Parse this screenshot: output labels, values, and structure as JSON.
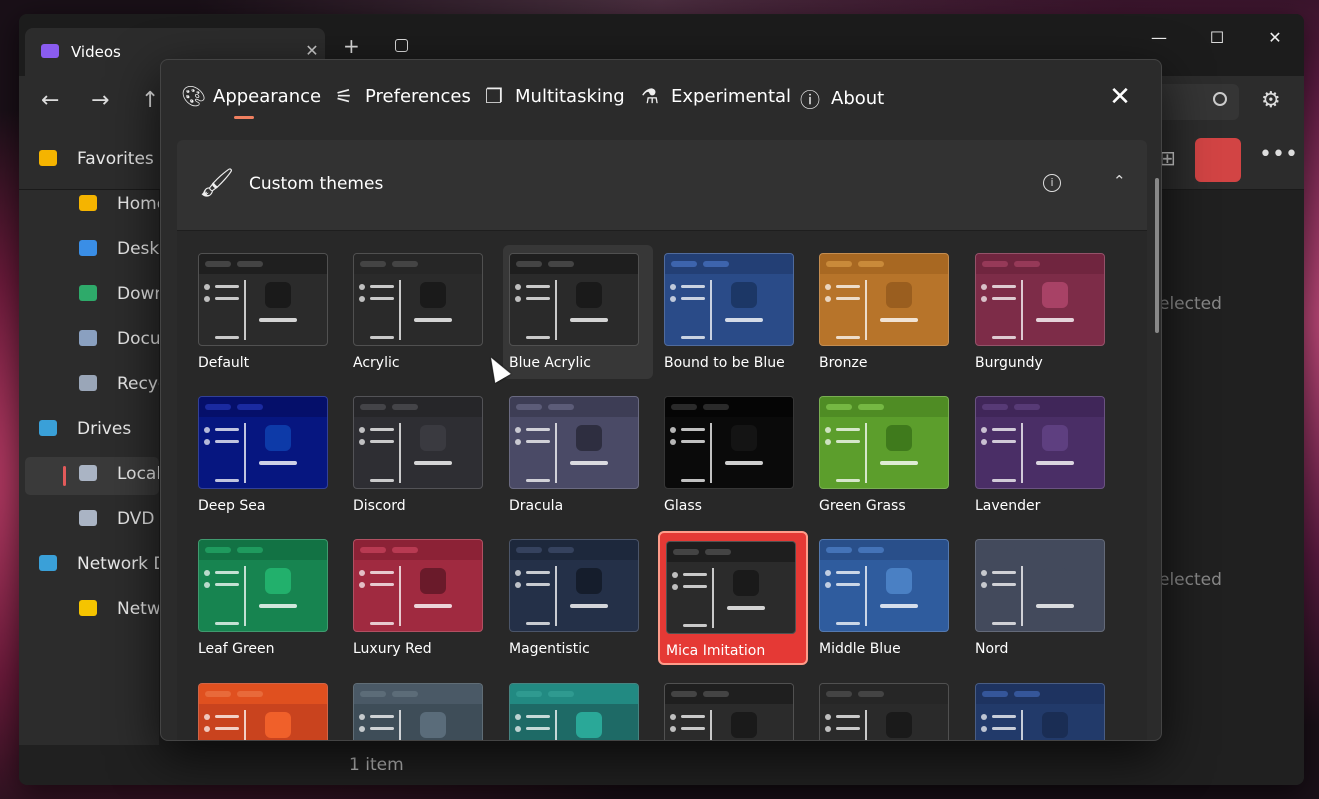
{
  "explorer": {
    "tab_title": "Videos",
    "tab_close": "✕",
    "new_tab": "+",
    "window_controls": {
      "minimize": "—",
      "maximize": "☐",
      "close": "✕"
    },
    "nav": {
      "back": "←",
      "forward": "→",
      "up": "↑"
    },
    "sidebar": [
      {
        "label": "Favorites",
        "icon": "star-icon",
        "color": "#f5b400"
      },
      {
        "label": "Home",
        "icon": "home-icon",
        "color": "#f5b400"
      },
      {
        "label": "Deskt",
        "icon": "desktop-icon",
        "color": "#3a8ee6"
      },
      {
        "label": "Down",
        "icon": "downloads-icon",
        "color": "#2eaa6a"
      },
      {
        "label": "Docu",
        "icon": "documents-icon",
        "color": "#8aa0c0"
      },
      {
        "label": "Recyc",
        "icon": "recycle-bin-icon",
        "color": "#9aa6b8"
      },
      {
        "label": "Drives",
        "icon": "drive-icon",
        "color": "#3aa0d8"
      },
      {
        "label": "Local",
        "icon": "local-disk-icon",
        "color": "#aab4c4"
      },
      {
        "label": "DVD I",
        "icon": "dvd-icon",
        "color": "#aab4c4"
      },
      {
        "label": "Network D",
        "icon": "network-icon",
        "color": "#3aa0d8"
      },
      {
        "label": "Netw",
        "icon": "folder-icon",
        "color": "#f5c400"
      }
    ],
    "content_texts": [
      "elected",
      "elected"
    ],
    "status": "1 item"
  },
  "dialog": {
    "tabs": [
      {
        "label": "Appearance",
        "icon": "palette-icon"
      },
      {
        "label": "Preferences",
        "icon": "sliders-icon"
      },
      {
        "label": "Multitasking",
        "icon": "windows-icon"
      },
      {
        "label": "Experimental",
        "icon": "flask-icon"
      },
      {
        "label": "About",
        "icon": "info-icon"
      }
    ],
    "close_icon": "✕",
    "expander": {
      "title": "Custom themes",
      "info": "i",
      "chevron": "⌃"
    },
    "accent_color": "#f08060",
    "themes": [
      {
        "name": "Default",
        "bg": "#2b2b2b",
        "head": "#1f1f1f",
        "accent": "#1a1a1a",
        "pill": "#444444"
      },
      {
        "name": "Acrylic",
        "bg": "#2a2a2a",
        "head": "#262626",
        "accent": "#1a1a1a",
        "pill": "#444444"
      },
      {
        "name": "Blue Acrylic",
        "bg": "#2a2a2a",
        "head": "#1e1e1e",
        "accent": "#1a1a1a",
        "pill": "#444444"
      },
      {
        "name": "Bound to be Blue",
        "bg": "#2a4b88",
        "head": "#233f75",
        "accent": "#1c3766",
        "pill": "#3d64ad"
      },
      {
        "name": "Bronze",
        "bg": "#b7742a",
        "head": "#a86822",
        "accent": "#9a5e1f",
        "pill": "#c98a3a"
      },
      {
        "name": "Burgundy",
        "bg": "#7d2c48",
        "head": "#70253f",
        "accent": "#a84266",
        "pill": "#963958"
      },
      {
        "name": "Deep Sea",
        "bg": "#061680",
        "head": "#050f6a",
        "accent": "#0d3aa8",
        "pill": "#1a2aa0"
      },
      {
        "name": "Discord",
        "bg": "#2e2e33",
        "head": "#262629",
        "accent": "#3a3a40",
        "pill": "#444448"
      },
      {
        "name": "Dracula",
        "bg": "#4a4a66",
        "head": "#3d3d55",
        "accent": "#2e2e40",
        "pill": "#5c5c78"
      },
      {
        "name": "Glass",
        "bg": "#0a0a0a",
        "head": "#050505",
        "accent": "#141414",
        "pill": "#2a2a2a"
      },
      {
        "name": "Green Grass",
        "bg": "#5c9e2c",
        "head": "#4f8c24",
        "accent": "#3f7a1c",
        "pill": "#75b843"
      },
      {
        "name": "Lavender",
        "bg": "#4a2e66",
        "head": "#402659",
        "accent": "#5e3f80",
        "pill": "#573a76"
      },
      {
        "name": "Leaf Green",
        "bg": "#178450",
        "head": "#127244",
        "accent": "#22b06c",
        "pill": "#1f9a5e"
      },
      {
        "name": "Luxury Red",
        "bg": "#a02a40",
        "head": "#8c2236",
        "accent": "#6a1a2a",
        "pill": "#b83a52"
      },
      {
        "name": "Magentistic",
        "bg": "#243048",
        "head": "#1d283c",
        "accent": "#151d2c",
        "pill": "#35425e"
      },
      {
        "name": "Mica Imitation",
        "bg": "#2b2b2b",
        "head": "#1e1e1e",
        "accent": "#1a1a1a",
        "pill": "#444444"
      },
      {
        "name": "Middle Blue",
        "bg": "#2f5c9e",
        "head": "#294f8a",
        "accent": "#4a80c4",
        "pill": "#4473b8"
      },
      {
        "name": "Nord",
        "bg": "#434a5c",
        "head": "#434a5c",
        "accent": "#434a5c",
        "pill": "#434a5c"
      },
      {
        "name": "",
        "bg": "#c9431e",
        "head": "#e0501f",
        "accent": "#f0602a",
        "pill": "#e86a3a"
      },
      {
        "name": "",
        "bg": "#3e4d58",
        "head": "#4a5966",
        "accent": "#5a6c7a",
        "pill": "#5c6c78"
      },
      {
        "name": "",
        "bg": "#1e6a66",
        "head": "#228a82",
        "accent": "#2aa898",
        "pill": "#2f9a90"
      },
      {
        "name": "",
        "bg": "#2b2b2b",
        "head": "#1f1f1f",
        "accent": "#1a1a1a",
        "pill": "#444444"
      },
      {
        "name": "",
        "bg": "#2a2a2a",
        "head": "#262626",
        "accent": "#1a1a1a",
        "pill": "#444444"
      },
      {
        "name": "",
        "bg": "#223a6a",
        "head": "#1e3360",
        "accent": "#1a2d54",
        "pill": "#35569a"
      }
    ],
    "hovered_theme": "Blue Acrylic",
    "selected_theme": "Mica Imitation"
  }
}
